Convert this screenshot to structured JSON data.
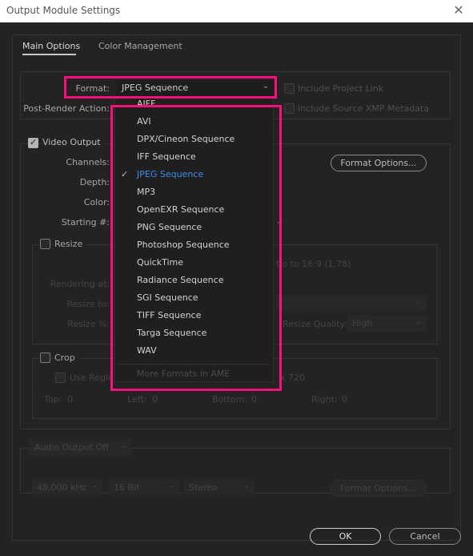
{
  "window": {
    "title": "Output Module Settings",
    "close_icon": "close-icon"
  },
  "tabs": [
    {
      "label": "Main Options",
      "active": true
    },
    {
      "label": "Color Management",
      "active": false
    }
  ],
  "format": {
    "label": "Format:",
    "value": "JPEG Sequence"
  },
  "post_render": {
    "label": "Post-Render Action:"
  },
  "include_project_link": {
    "label": "Include Project Link",
    "checked": false
  },
  "include_xmp": {
    "label": "Include Source XMP Metadata",
    "checked": false
  },
  "video_output": {
    "label": "Video Output",
    "checked": true,
    "channels_label": "Channels:",
    "depth_label": "Depth:",
    "color_label": "Color:",
    "starting_label": "Starting #:",
    "format_options": "Format Options..."
  },
  "resize": {
    "label": "Resize",
    "checked": false,
    "rendering_at": "Rendering at:",
    "resize_to": "Resize to:",
    "resize_pct": "Resize %:",
    "lock_ratio_text": "tio to 16:9 (1.78)",
    "quality_label": "Resize Quality:",
    "quality_value": "High"
  },
  "crop": {
    "label": "Crop",
    "checked": false,
    "use_region": "Use Regio",
    "region_text": "x 720",
    "top_label": "Top:",
    "top_value": "0",
    "left_label": "Left:",
    "left_value": "0",
    "bottom_label": "Bottom:",
    "bottom_value": "0",
    "right_label": "Right:",
    "right_value": "0"
  },
  "audio": {
    "mode": "Audio Output Off",
    "rate": "48.000 kHz",
    "bits": "16 Bit",
    "channels": "Stereo",
    "format_options": "Format Options..."
  },
  "format_menu": {
    "items": [
      {
        "label": "AIFF",
        "selected": false
      },
      {
        "label": "AVI",
        "selected": false
      },
      {
        "label": "DPX/Cineon Sequence",
        "selected": false
      },
      {
        "label": "IFF Sequence",
        "selected": false
      },
      {
        "label": "JPEG Sequence",
        "selected": true
      },
      {
        "label": "MP3",
        "selected": false
      },
      {
        "label": "OpenEXR Sequence",
        "selected": false
      },
      {
        "label": "PNG Sequence",
        "selected": false
      },
      {
        "label": "Photoshop Sequence",
        "selected": false
      },
      {
        "label": "QuickTime",
        "selected": false
      },
      {
        "label": "Radiance Sequence",
        "selected": false
      },
      {
        "label": "SGI Sequence",
        "selected": false
      },
      {
        "label": "TIFF Sequence",
        "selected": false
      },
      {
        "label": "Targa Sequence",
        "selected": false
      },
      {
        "label": "WAV",
        "selected": false
      }
    ],
    "more": "More Formats in AME"
  },
  "buttons": {
    "ok": "OK",
    "cancel": "Cancel"
  },
  "colors": {
    "highlight": "#ff0f7b",
    "selected_item": "#3d8eeb"
  }
}
